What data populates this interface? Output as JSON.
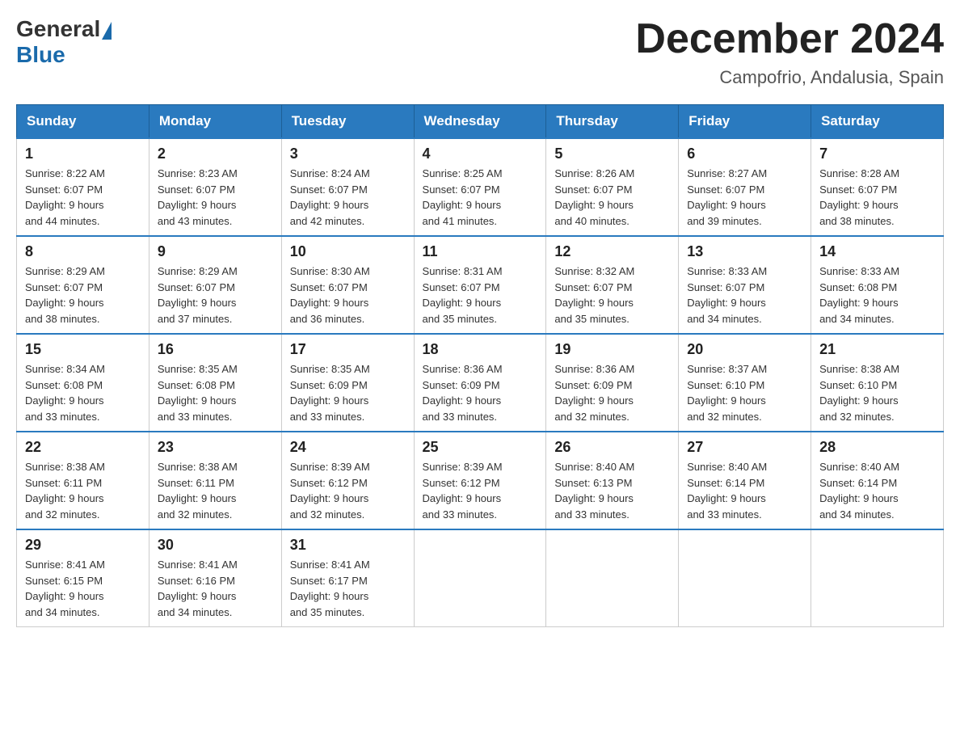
{
  "header": {
    "logo_general": "General",
    "logo_blue": "Blue",
    "title": "December 2024",
    "subtitle": "Campofrio, Andalusia, Spain"
  },
  "columns": [
    "Sunday",
    "Monday",
    "Tuesday",
    "Wednesday",
    "Thursday",
    "Friday",
    "Saturday"
  ],
  "weeks": [
    [
      {
        "day": "1",
        "sunrise": "8:22 AM",
        "sunset": "6:07 PM",
        "daylight": "9 hours and 44 minutes."
      },
      {
        "day": "2",
        "sunrise": "8:23 AM",
        "sunset": "6:07 PM",
        "daylight": "9 hours and 43 minutes."
      },
      {
        "day": "3",
        "sunrise": "8:24 AM",
        "sunset": "6:07 PM",
        "daylight": "9 hours and 42 minutes."
      },
      {
        "day": "4",
        "sunrise": "8:25 AM",
        "sunset": "6:07 PM",
        "daylight": "9 hours and 41 minutes."
      },
      {
        "day": "5",
        "sunrise": "8:26 AM",
        "sunset": "6:07 PM",
        "daylight": "9 hours and 40 minutes."
      },
      {
        "day": "6",
        "sunrise": "8:27 AM",
        "sunset": "6:07 PM",
        "daylight": "9 hours and 39 minutes."
      },
      {
        "day": "7",
        "sunrise": "8:28 AM",
        "sunset": "6:07 PM",
        "daylight": "9 hours and 38 minutes."
      }
    ],
    [
      {
        "day": "8",
        "sunrise": "8:29 AM",
        "sunset": "6:07 PM",
        "daylight": "9 hours and 38 minutes."
      },
      {
        "day": "9",
        "sunrise": "8:29 AM",
        "sunset": "6:07 PM",
        "daylight": "9 hours and 37 minutes."
      },
      {
        "day": "10",
        "sunrise": "8:30 AM",
        "sunset": "6:07 PM",
        "daylight": "9 hours and 36 minutes."
      },
      {
        "day": "11",
        "sunrise": "8:31 AM",
        "sunset": "6:07 PM",
        "daylight": "9 hours and 35 minutes."
      },
      {
        "day": "12",
        "sunrise": "8:32 AM",
        "sunset": "6:07 PM",
        "daylight": "9 hours and 35 minutes."
      },
      {
        "day": "13",
        "sunrise": "8:33 AM",
        "sunset": "6:07 PM",
        "daylight": "9 hours and 34 minutes."
      },
      {
        "day": "14",
        "sunrise": "8:33 AM",
        "sunset": "6:08 PM",
        "daylight": "9 hours and 34 minutes."
      }
    ],
    [
      {
        "day": "15",
        "sunrise": "8:34 AM",
        "sunset": "6:08 PM",
        "daylight": "9 hours and 33 minutes."
      },
      {
        "day": "16",
        "sunrise": "8:35 AM",
        "sunset": "6:08 PM",
        "daylight": "9 hours and 33 minutes."
      },
      {
        "day": "17",
        "sunrise": "8:35 AM",
        "sunset": "6:09 PM",
        "daylight": "9 hours and 33 minutes."
      },
      {
        "day": "18",
        "sunrise": "8:36 AM",
        "sunset": "6:09 PM",
        "daylight": "9 hours and 33 minutes."
      },
      {
        "day": "19",
        "sunrise": "8:36 AM",
        "sunset": "6:09 PM",
        "daylight": "9 hours and 32 minutes."
      },
      {
        "day": "20",
        "sunrise": "8:37 AM",
        "sunset": "6:10 PM",
        "daylight": "9 hours and 32 minutes."
      },
      {
        "day": "21",
        "sunrise": "8:38 AM",
        "sunset": "6:10 PM",
        "daylight": "9 hours and 32 minutes."
      }
    ],
    [
      {
        "day": "22",
        "sunrise": "8:38 AM",
        "sunset": "6:11 PM",
        "daylight": "9 hours and 32 minutes."
      },
      {
        "day": "23",
        "sunrise": "8:38 AM",
        "sunset": "6:11 PM",
        "daylight": "9 hours and 32 minutes."
      },
      {
        "day": "24",
        "sunrise": "8:39 AM",
        "sunset": "6:12 PM",
        "daylight": "9 hours and 32 minutes."
      },
      {
        "day": "25",
        "sunrise": "8:39 AM",
        "sunset": "6:12 PM",
        "daylight": "9 hours and 33 minutes."
      },
      {
        "day": "26",
        "sunrise": "8:40 AM",
        "sunset": "6:13 PM",
        "daylight": "9 hours and 33 minutes."
      },
      {
        "day": "27",
        "sunrise": "8:40 AM",
        "sunset": "6:14 PM",
        "daylight": "9 hours and 33 minutes."
      },
      {
        "day": "28",
        "sunrise": "8:40 AM",
        "sunset": "6:14 PM",
        "daylight": "9 hours and 34 minutes."
      }
    ],
    [
      {
        "day": "29",
        "sunrise": "8:41 AM",
        "sunset": "6:15 PM",
        "daylight": "9 hours and 34 minutes."
      },
      {
        "day": "30",
        "sunrise": "8:41 AM",
        "sunset": "6:16 PM",
        "daylight": "9 hours and 34 minutes."
      },
      {
        "day": "31",
        "sunrise": "8:41 AM",
        "sunset": "6:17 PM",
        "daylight": "9 hours and 35 minutes."
      },
      null,
      null,
      null,
      null
    ]
  ],
  "labels": {
    "sunrise": "Sunrise:",
    "sunset": "Sunset:",
    "daylight": "Daylight:"
  }
}
